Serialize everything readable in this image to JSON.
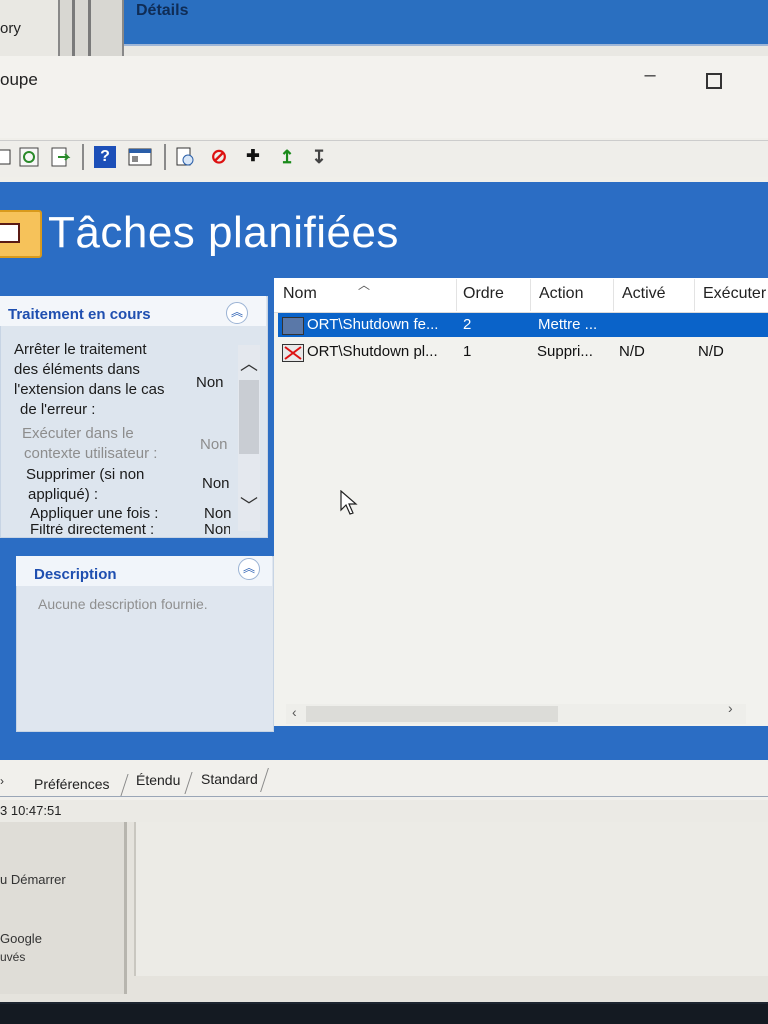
{
  "background_app": {
    "left_label": "ory",
    "details_label": "Détails"
  },
  "window": {
    "title": "oupe",
    "minimize_glyph": "–",
    "toolbar_glyphs": [
      "?",
      "⊘",
      "✚",
      "↥",
      "↧"
    ]
  },
  "header": {
    "title": "Tâches planifiées"
  },
  "processing_panel": {
    "title": "Traitement en cours",
    "properties": [
      {
        "label_lines": [
          "Arrêter le traitement",
          "des éléments dans",
          "l'extension dans le cas",
          "de l'erreur :"
        ],
        "value": "Non",
        "dim": false
      },
      {
        "label_lines": [
          "Exécuter dans le",
          "contexte utilisateur :"
        ],
        "value": "Non",
        "dim": true
      },
      {
        "label_lines": [
          "Supprimer (si non",
          "appliqué) :"
        ],
        "value": "Non",
        "dim": false
      },
      {
        "label_lines": [
          "Appliquer une fois :"
        ],
        "value": "Non",
        "dim": false
      },
      {
        "label_lines": [
          "Filtré directement :"
        ],
        "value": "Non",
        "dim": false
      }
    ]
  },
  "description_panel": {
    "title": "Description",
    "text": "Aucune description fournie."
  },
  "list": {
    "columns": [
      "Nom",
      "Ordre",
      "Action",
      "Activé",
      "Exécuter"
    ],
    "rows": [
      {
        "name": "ORT\\Shutdown fe...",
        "order": "2",
        "action": "Mettre ...",
        "enabled": "",
        "run": "",
        "selected": true
      },
      {
        "name": "ORT\\Shutdown pl...",
        "order": "1",
        "action": "Suppri...",
        "enabled": "N/D",
        "run": "N/D",
        "selected": false
      }
    ]
  },
  "tabs": [
    "Préférences",
    "Étendu",
    "Standard"
  ],
  "status": {
    "time": "3 10:47:51"
  },
  "bottom_left": {
    "lines": [
      "u Démarrer",
      "Google",
      "uvés"
    ]
  },
  "colors": {
    "accent_blue": "#2b6dc4",
    "selection": "#0a63c9",
    "panel_title": "#1f4fb0"
  }
}
